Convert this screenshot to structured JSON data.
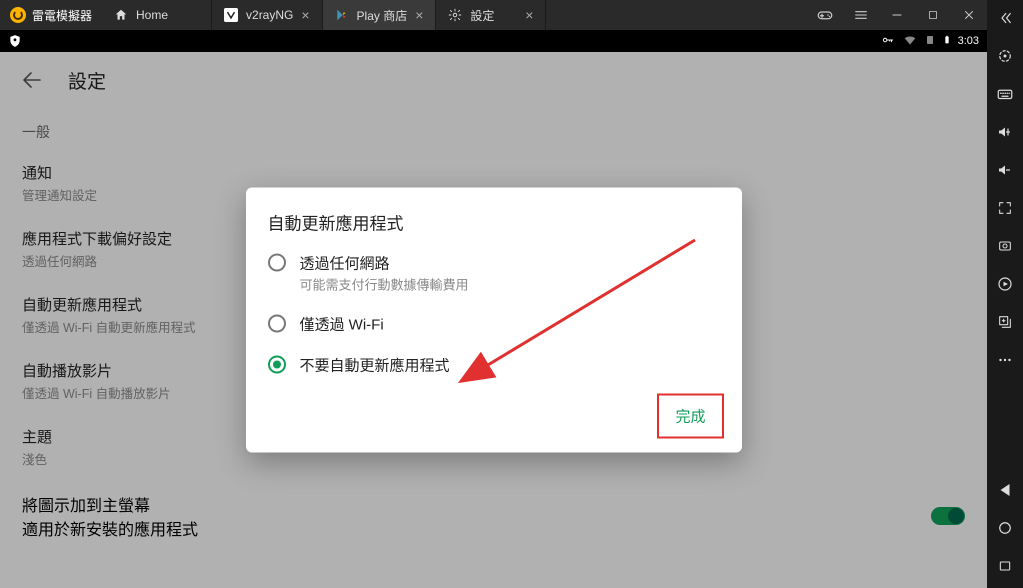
{
  "emulator": {
    "brand": "雷電模擬器",
    "tabs": [
      {
        "label": "Home",
        "icon": "home-icon",
        "active": false
      },
      {
        "label": "v2rayNG",
        "icon": "v2ray-icon",
        "active": false
      },
      {
        "label": "Play 商店",
        "icon": "play-icon",
        "active": true
      },
      {
        "label": "設定",
        "icon": "gear-icon",
        "active": false
      }
    ]
  },
  "androidStatus": {
    "time": "3:03"
  },
  "settings": {
    "title": "設定",
    "section_general": "一般",
    "items": {
      "notifications": {
        "title": "通知",
        "sub": "管理通知設定"
      },
      "download_pref": {
        "title": "應用程式下載偏好設定",
        "sub": "透過任何網路"
      },
      "auto_update": {
        "title": "自動更新應用程式",
        "sub": "僅透過 Wi-Fi 自動更新應用程式"
      },
      "auto_play": {
        "title": "自動播放影片",
        "sub": "僅透過 Wi-Fi 自動播放影片"
      },
      "theme": {
        "title": "主題",
        "sub": "淺色"
      },
      "add_home": {
        "title": "將圖示加到主螢幕",
        "sub": "適用於新安裝的應用程式"
      }
    }
  },
  "dialog": {
    "title": "自動更新應用程式",
    "options": [
      {
        "title": "透過任何網路",
        "sub": "可能需支付行動數據傳輸費用",
        "checked": false
      },
      {
        "title": "僅透過 Wi-Fi",
        "sub": "",
        "checked": false
      },
      {
        "title": "不要自動更新應用程式",
        "sub": "",
        "checked": true
      }
    ],
    "done": "完成"
  }
}
